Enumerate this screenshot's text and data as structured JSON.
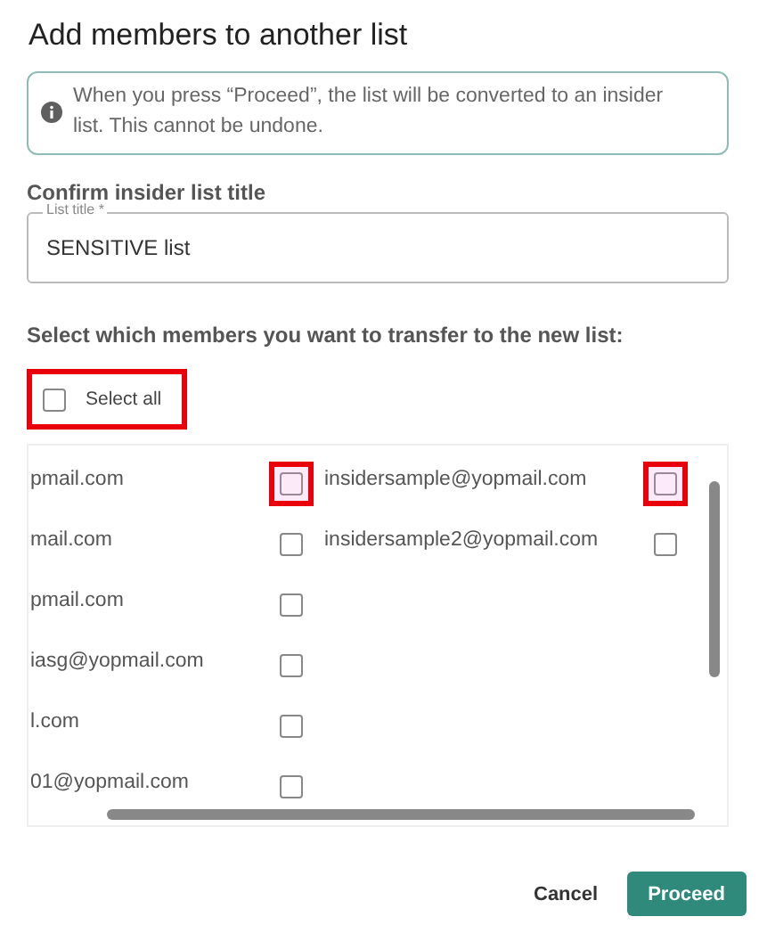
{
  "dialog": {
    "title": "Add members to another list"
  },
  "notice": {
    "text": "When you press “Proceed”, the list will be converted to an insider list. This cannot be undone."
  },
  "title_section": {
    "heading": "Confirm insider list title",
    "field": {
      "label": "List title *",
      "value": "SENSITIVE list"
    }
  },
  "members_section": {
    "heading": "Select which members you want to transfer to the new list:"
  },
  "select_all": {
    "label": "Select all",
    "checked": false,
    "highlighted": true
  },
  "member_columns": [
    {
      "members": [
        {
          "email": "pmail.com",
          "checked": false,
          "highlighted": true
        },
        {
          "email": "mail.com",
          "checked": false,
          "highlighted": false
        },
        {
          "email": "pmail.com",
          "checked": false,
          "highlighted": false
        },
        {
          "email": "iasg@yopmail.com",
          "checked": false,
          "highlighted": false
        },
        {
          "email": "l.com",
          "checked": false,
          "highlighted": false
        },
        {
          "email": "01@yopmail.com",
          "checked": false,
          "highlighted": false
        }
      ]
    },
    {
      "members": [
        {
          "email": "insidersample@yopmail.com",
          "checked": false,
          "highlighted": true
        },
        {
          "email": "insidersample2@yopmail.com",
          "checked": false,
          "highlighted": false
        }
      ]
    }
  ],
  "buttons": [
    {
      "label": "Cancel",
      "kind": "text"
    },
    {
      "label": "Proceed",
      "kind": "primary"
    }
  ]
}
